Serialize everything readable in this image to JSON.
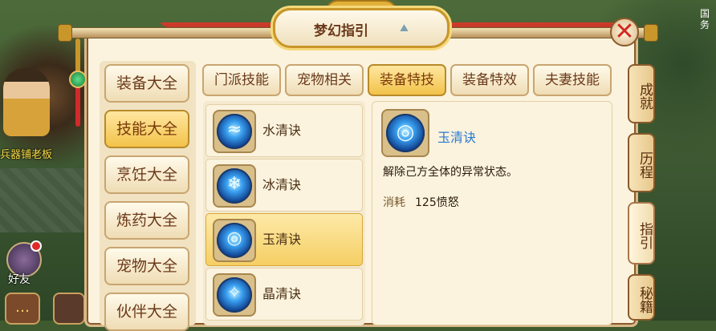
{
  "background": {
    "npc_label": "兵器铺老板",
    "friends_label": "好友",
    "right_corner_text": "国务"
  },
  "dialog": {
    "title": "梦幻指引",
    "close_icon": "close-x-icon"
  },
  "left_categories": [
    {
      "label": "装备大全",
      "active": false
    },
    {
      "label": "技能大全",
      "active": true
    },
    {
      "label": "烹饪大全",
      "active": false
    },
    {
      "label": "炼药大全",
      "active": false
    },
    {
      "label": "宠物大全",
      "active": false
    },
    {
      "label": "伙伴大全",
      "active": false
    }
  ],
  "tabs": [
    {
      "label": "门派技能",
      "active": false
    },
    {
      "label": "宠物相关",
      "active": false
    },
    {
      "label": "装备特技",
      "active": true
    },
    {
      "label": "装备特效",
      "active": false
    },
    {
      "label": "夫妻技能",
      "active": false
    }
  ],
  "skills": [
    {
      "name": "水清诀",
      "icon": "water-swirl-icon",
      "active": false
    },
    {
      "name": "冰清诀",
      "icon": "snowflake-icon",
      "active": false
    },
    {
      "name": "玉清诀",
      "icon": "jade-orb-icon",
      "active": true
    },
    {
      "name": "晶清诀",
      "icon": "crystal-icon",
      "active": false
    }
  ],
  "detail": {
    "name": "玉清诀",
    "description": "解除己方全体的异常状态。",
    "cost_label": "消耗",
    "cost_value": "125愤怒"
  },
  "right_tabs": [
    {
      "label": "成就",
      "active": false
    },
    {
      "label": "历程",
      "active": false
    },
    {
      "label": "指引",
      "active": true
    },
    {
      "label": "秘籍",
      "active": false
    }
  ],
  "colors": {
    "active_gold": "#f2c34a",
    "panel_bg": "#fbf3de",
    "detail_name": "#2a7ad0",
    "close_red": "#d12a1e"
  }
}
